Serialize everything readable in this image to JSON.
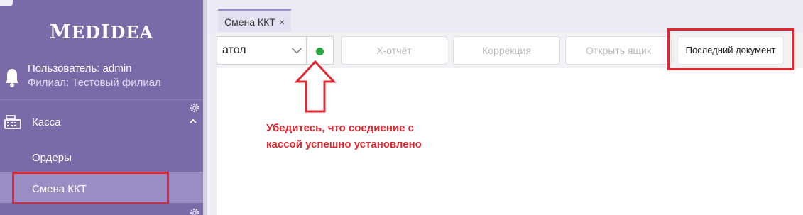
{
  "app": {
    "brand": "MedIdea"
  },
  "user": {
    "name_line": "Пользователь: admin",
    "branch_line": "Филиал: Тестовый филиал"
  },
  "sidebar": {
    "section": {
      "label": "Касса",
      "icon": "cash-register-icon",
      "expanded": true
    },
    "items": [
      {
        "label": "Ордеры",
        "active": false
      },
      {
        "label": "Смена ККТ",
        "active": true
      }
    ]
  },
  "tabs": [
    {
      "label": "Смена ККТ",
      "close": "×"
    }
  ],
  "toolbar": {
    "device_select": {
      "value": "атол"
    },
    "connection_status": {
      "color": "#23a63d",
      "state": "connected"
    },
    "buttons": {
      "x_report": "X-отчёт",
      "correction": "Коррекция",
      "open_drawer": "Открыть ящик",
      "last_document": "Последний документ"
    }
  },
  "annotation": {
    "text": "Убедитесь, что соедиение с кассой успешно установлено"
  },
  "colors": {
    "sidebar": "#7b6aa8",
    "active_item": "#9a8dc3",
    "highlight": "#e0262e",
    "status_ok": "#23a63d"
  }
}
